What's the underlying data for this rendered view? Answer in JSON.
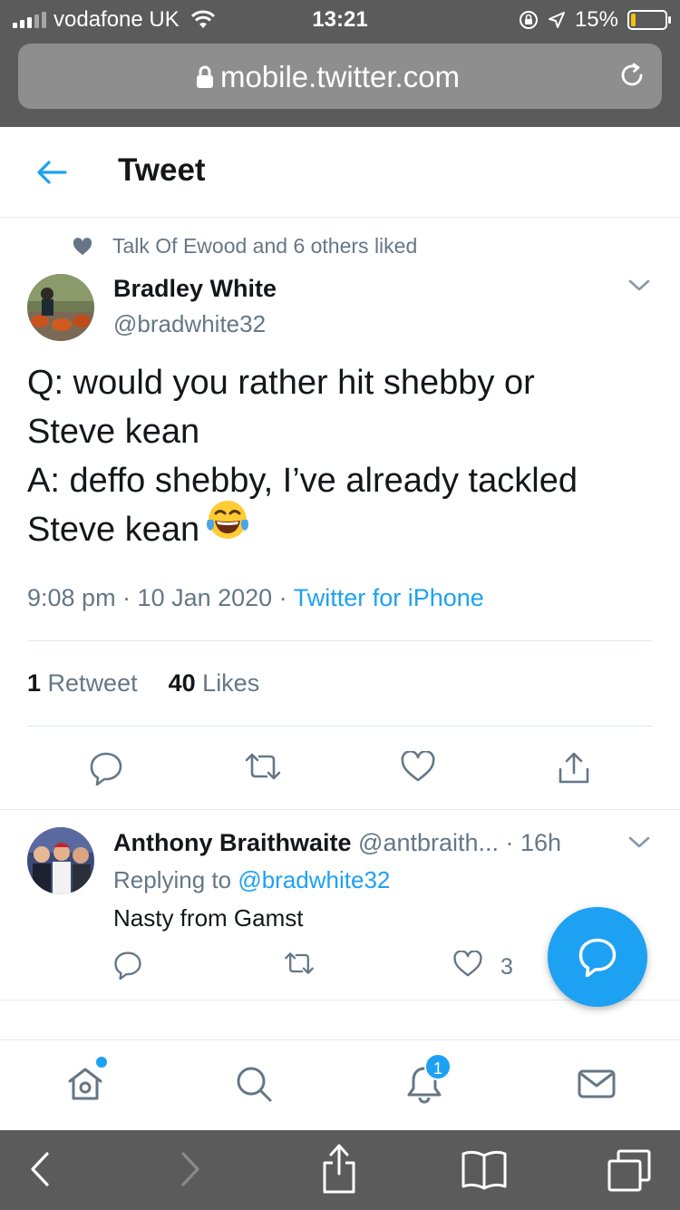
{
  "status_bar": {
    "carrier": "vodafone UK",
    "time": "13:21",
    "battery": "15%",
    "battery_level": 0.15
  },
  "browser": {
    "url": "mobile.twitter.com"
  },
  "header": {
    "title": "Tweet"
  },
  "tweet": {
    "social_context": "Talk Of Ewood and 6 others liked",
    "author_name": "Bradley White",
    "author_handle": "@bradwhite32",
    "text_lines": [
      "Q: would you rather hit shebby or",
      "Steve kean",
      "A: deffo shebby, I’ve already tackled",
      "Steve kean"
    ],
    "emoji": "face-with-tears-of-joy",
    "timestamp": "9:08 pm · 10 Jan 2020 · ",
    "source": "Twitter for iPhone",
    "retweet_count": "1",
    "retweet_label": "Retweet",
    "like_count": "40",
    "like_label": "Likes"
  },
  "reply": {
    "author_name": "Anthony Braithwaite",
    "author_handle": "@antbraith...",
    "time": " · 16h",
    "replying_prefix": "Replying to ",
    "replying_to": "@bradwhite32",
    "text": "Nasty from Gamst",
    "like_count": "3"
  },
  "tab_bar": {
    "notifications_badge": "1"
  },
  "colors": {
    "accent": "#1da1f2",
    "secondary_text": "#657786",
    "browser_chrome": "#5b5b5b",
    "battery_low": "#f4c20d"
  }
}
